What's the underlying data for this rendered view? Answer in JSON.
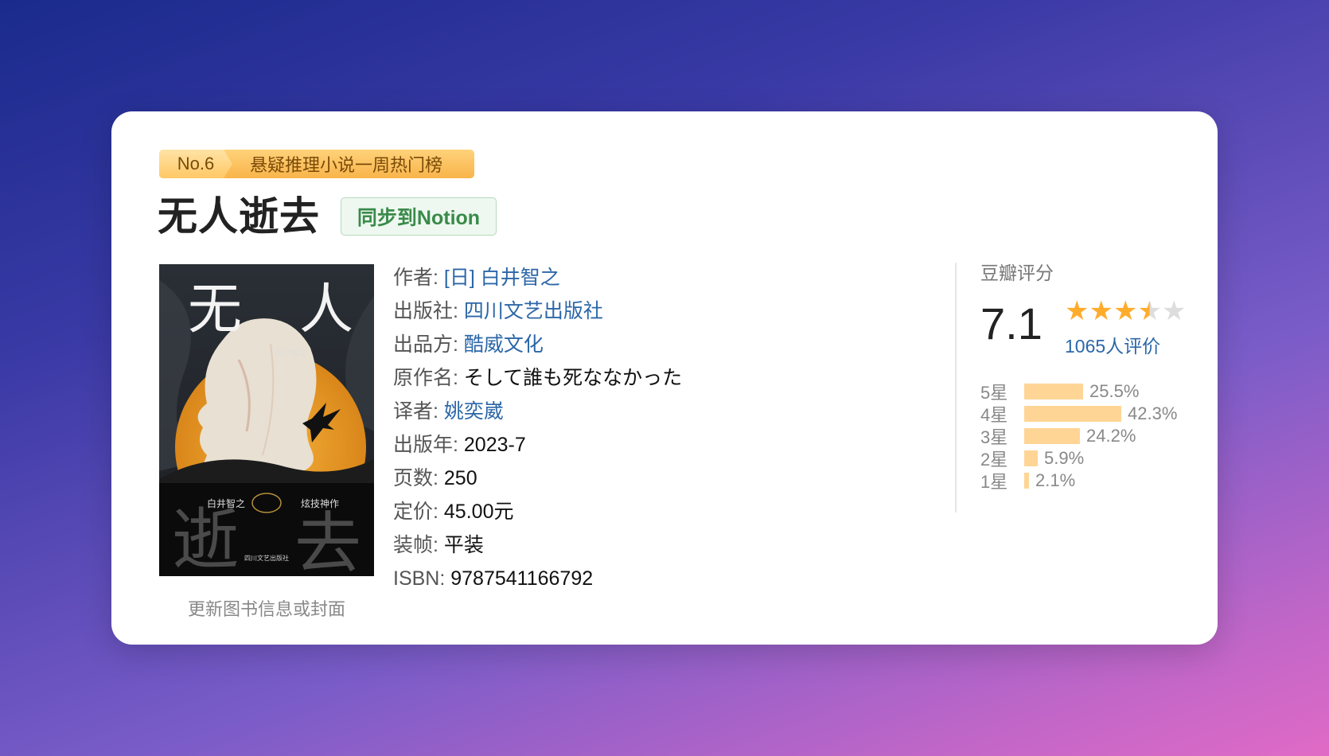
{
  "rank": {
    "number": "No.6",
    "list_name": "悬疑推理小说一周热门榜"
  },
  "book": {
    "title": "无人逝去"
  },
  "sync_button": "同步到Notion",
  "cover": {
    "title_top": "无 人",
    "title_bottom": "逝 去",
    "author": "白井智之",
    "tagline": "炫技神作",
    "publisher": "四川文艺出版社",
    "update_link": "更新图书信息或封面"
  },
  "info": [
    {
      "label": "作者:",
      "value": "[日] 白井智之",
      "link": true
    },
    {
      "label": "出版社:",
      "value": "四川文艺出版社",
      "link": true
    },
    {
      "label": "出品方:",
      "value": "酷威文化",
      "link": true
    },
    {
      "label": "原作名:",
      "value": "そして誰も死ななかった",
      "link": false
    },
    {
      "label": "译者:",
      "value": "姚奕崴",
      "link": true
    },
    {
      "label": "出版年:",
      "value": "2023-7",
      "link": false
    },
    {
      "label": "页数:",
      "value": "250",
      "link": false
    },
    {
      "label": "定价:",
      "value": "45.00元",
      "link": false
    },
    {
      "label": "装帧:",
      "value": "平装",
      "link": false
    },
    {
      "label": "ISBN:",
      "value": "9787541166792",
      "link": false
    }
  ],
  "rating": {
    "title": "豆瓣评分",
    "score": "7.1",
    "stars_filled": 3.5,
    "count_text": "1065人评价",
    "distribution": [
      {
        "label": "5星",
        "percent": "25.5%",
        "value": 25.5
      },
      {
        "label": "4星",
        "percent": "42.3%",
        "value": 42.3
      },
      {
        "label": "3星",
        "percent": "24.2%",
        "value": 24.2
      },
      {
        "label": "2星",
        "percent": "5.9%",
        "value": 5.9
      },
      {
        "label": "1星",
        "percent": "2.1%",
        "value": 2.1
      }
    ]
  },
  "colors": {
    "link": "#2c67a8",
    "star": "#ffac2d",
    "star_empty": "#dddddd",
    "bar": "#ffd596",
    "sync_green": "#3a8a4a"
  }
}
